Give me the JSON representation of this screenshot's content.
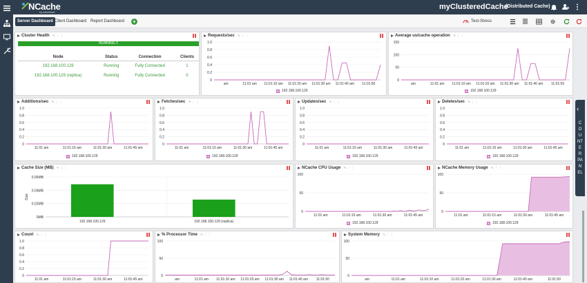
{
  "app": {
    "logo_text": "NCache",
    "logo_sub": "by Alachisoft",
    "cache_name": "myClusteredCache",
    "cache_type": "(Distributed Cache)"
  },
  "tabs": [
    {
      "label": "Server Dashboard",
      "active": true
    },
    {
      "label": "Client Dashboard",
      "active": false
    },
    {
      "label": "Report Dashboard",
      "active": false
    }
  ],
  "toolbar": {
    "stress_label": "Test-Stress"
  },
  "counter_panel": {
    "label": "COUNTER PANEL"
  },
  "cluster_health": {
    "title": "Cluster Health",
    "status": "RUNNING 2",
    "columns": [
      "Node",
      "Status",
      "Connection",
      "Clients"
    ],
    "rows": [
      [
        "192.168.100.129",
        "Running",
        "Fully Connected",
        "1"
      ],
      [
        "192.168.100.129 (replica)",
        "Running",
        "Fully Connected",
        "0"
      ]
    ]
  },
  "panels": {
    "requests": {
      "title": "Requests/sec",
      "legend": "192.168.100.129"
    },
    "avg_us": {
      "title": "Average us/cache operation",
      "legend": "192.168.100.129"
    },
    "additions": {
      "title": "Additions/sec",
      "legend": "192.168.100.129"
    },
    "fetches": {
      "title": "Fetches/sec",
      "legend": "192.168.100.129"
    },
    "updates": {
      "title": "Updates/sec",
      "legend": "192.168.100.129"
    },
    "deletes": {
      "title": "Deletes/sec",
      "legend": "192.168.100.129"
    },
    "cache_size": {
      "title": "Cache Size (MB)"
    },
    "cpu": {
      "title": "NCache CPU Usage",
      "legend": "192.168.100.129"
    },
    "memory": {
      "title": "NCache Memory Usage",
      "legend": "192.168.100.129"
    },
    "count": {
      "title": "Count"
    },
    "processor": {
      "title": "% Processor Time"
    },
    "sysmem": {
      "title": "System Memory"
    }
  },
  "chart_data": [
    {
      "id": "requests",
      "type": "line",
      "y_ticks": [
        "0",
        "0.2",
        "0.4",
        "0.6",
        "0.8",
        "1.0"
      ],
      "ylim": [
        0,
        1
      ],
      "x_ticks": [
        "am",
        "11:01 am",
        "11:01:10 am",
        "11:01:20 am",
        "11:01:30 am",
        "11:01:40 am",
        "11:01:50"
      ],
      "series": [
        {
          "name": "192.168.100.129",
          "values": [
            0,
            0,
            0,
            0,
            0,
            0,
            0,
            0,
            0,
            0,
            0,
            0,
            0,
            0,
            0,
            0,
            0,
            0,
            0,
            0,
            0,
            0,
            0,
            0,
            0,
            0,
            0,
            0.9,
            0,
            0,
            0.45,
            0.45,
            0,
            0,
            0,
            0,
            0,
            0,
            0,
            0.4
          ]
        }
      ]
    },
    {
      "id": "avg_us",
      "type": "line",
      "y_ticks": [
        "0",
        "50",
        "100",
        "150"
      ],
      "ylim": [
        0,
        150
      ],
      "x_ticks": [
        "am",
        "11:01 am",
        "11:01:10 am",
        "11:01:20 am",
        "11:01:30 am",
        "11:01:40 am",
        "11:01:50"
      ],
      "series": [
        {
          "name": "192.168.100.129",
          "values": [
            0,
            0,
            0,
            0,
            0,
            0,
            0,
            0,
            0,
            0,
            0,
            0,
            0,
            0,
            0,
            0,
            0,
            0,
            0,
            0,
            0,
            0,
            0,
            0,
            0,
            0,
            0,
            125,
            0,
            0,
            65,
            65,
            0,
            0,
            0,
            0,
            0,
            0,
            0,
            125
          ]
        }
      ]
    },
    {
      "id": "additions",
      "type": "line",
      "y_ticks": [
        "0",
        "0.2",
        "0.4",
        "0.6",
        "0.8",
        "1.0"
      ],
      "ylim": [
        0,
        1
      ],
      "x_ticks": [
        "11:01 am",
        "11:01:15 am",
        "11:01:30 am",
        "11:01:45 am"
      ],
      "series": [
        {
          "name": "192.168.100.129",
          "values": [
            0,
            0,
            0,
            0,
            0,
            0,
            0,
            0,
            0,
            0,
            0,
            0,
            0,
            0,
            0,
            0,
            0,
            0,
            0,
            0,
            0,
            0,
            0,
            0,
            0,
            0,
            0,
            0.9,
            0,
            0,
            0,
            0,
            0,
            0,
            0,
            0,
            0,
            0,
            0,
            0
          ]
        }
      ]
    },
    {
      "id": "fetches",
      "type": "line",
      "y_ticks": [
        "0",
        "0.2",
        "0.4",
        "0.6",
        "0.8",
        "1.0"
      ],
      "ylim": [
        0,
        1
      ],
      "x_ticks": [
        "11:01 am",
        "11:01:15 am",
        "11:01:30 am",
        "11:01:45 am"
      ],
      "series": [
        {
          "name": "192.168.100.129",
          "values": [
            0,
            0,
            0,
            0,
            0,
            0,
            0,
            0,
            0,
            0,
            0,
            0,
            0,
            0,
            0,
            0,
            0,
            0,
            0,
            0,
            0,
            0,
            0,
            0,
            0,
            0,
            0,
            0.9,
            0,
            0,
            0.9,
            0.9,
            0,
            0,
            0,
            0,
            0,
            0,
            0,
            0
          ]
        }
      ]
    },
    {
      "id": "updates",
      "type": "line",
      "y_ticks": [
        "0",
        "0.2",
        "0.4",
        "0.6",
        "0.8",
        "1.0"
      ],
      "ylim": [
        0,
        1
      ],
      "x_ticks": [
        "11:01 am",
        "11:01:15 am",
        "11:01:30 am",
        "11:01:45 am"
      ],
      "series": [
        {
          "name": "192.168.100.129",
          "values": [
            0,
            0,
            0,
            0,
            0,
            0,
            0,
            0,
            0,
            0,
            0,
            0,
            0,
            0,
            0,
            0,
            0,
            0,
            0,
            0,
            0,
            0,
            0,
            0,
            0,
            0,
            0,
            0,
            0,
            0,
            0,
            0,
            0,
            0,
            0,
            0,
            0,
            0,
            0,
            0
          ]
        }
      ]
    },
    {
      "id": "deletes",
      "type": "line",
      "y_ticks": [
        "0",
        "0.2",
        "0.4",
        "0.6",
        "0.8",
        "1.0"
      ],
      "ylim": [
        0,
        1
      ],
      "x_ticks": [
        "11:01 am",
        "11:01:15 am",
        "11:01:30 am",
        "11:01:45 am"
      ],
      "series": [
        {
          "name": "192.168.100.129",
          "values": [
            0,
            0,
            0,
            0,
            0,
            0,
            0,
            0,
            0,
            0,
            0,
            0,
            0,
            0,
            0,
            0,
            0,
            0,
            0,
            0,
            0,
            0,
            0,
            0,
            0,
            0,
            0,
            0,
            0,
            0,
            0,
            0,
            0,
            0,
            0,
            0,
            0,
            0,
            0,
            0
          ]
        }
      ]
    },
    {
      "id": "cache_size",
      "type": "bar",
      "ylabel": "Size",
      "y_ticks": [
        "0MB",
        "0.02MB",
        "0.04MB",
        "0.06MB"
      ],
      "ylim": [
        0,
        0.06
      ],
      "categories": [
        "192.168.100.129",
        "192.168.100.129 (replica)"
      ],
      "values": [
        0.049,
        0.026
      ],
      "color": "#1aa01a"
    },
    {
      "id": "cpu",
      "type": "line",
      "y_ticks": [
        "0",
        "50",
        "100"
      ],
      "ylim": [
        0,
        100
      ],
      "x_ticks": [
        "11:01 am",
        "11:01:15 am",
        "11:01:30 am",
        "11:01:45 am"
      ],
      "series": [
        {
          "name": "192.168.100.129",
          "values": [
            0,
            0,
            0,
            0,
            0,
            0,
            0,
            0,
            0,
            0,
            0,
            0,
            0,
            0,
            0,
            0,
            0,
            0,
            0,
            0,
            0,
            0,
            0,
            0,
            0,
            0,
            0,
            0,
            1,
            0,
            2,
            0,
            1,
            3,
            1,
            2,
            4,
            2,
            3,
            6
          ]
        }
      ]
    },
    {
      "id": "memory",
      "type": "area",
      "y_ticks": [
        "0",
        "50",
        "100"
      ],
      "ylim": [
        0,
        100
      ],
      "x_ticks": [
        "11:01 am",
        "11:01:15 am",
        "11:01:30 am",
        "11:01:45 am"
      ],
      "series": [
        {
          "name": "192.168.100.129",
          "values": [
            0,
            0,
            0,
            0,
            0,
            0,
            0,
            0,
            0,
            0,
            0,
            0,
            0,
            0,
            0,
            0,
            0,
            0,
            0,
            0,
            0,
            0,
            0,
            0,
            0,
            0,
            0,
            92,
            92,
            92,
            92,
            92,
            92,
            92,
            92,
            92,
            92,
            93,
            93,
            94
          ]
        }
      ]
    },
    {
      "id": "count",
      "type": "line",
      "y_ticks": [
        "0",
        "0.2",
        "0.4",
        "0.6",
        "0.8",
        "1.0"
      ],
      "ylim": [
        0,
        1
      ],
      "x_ticks": [
        "11:01 am",
        "11:01:15 am",
        "11:01:30 am",
        "11:01:45 am"
      ],
      "series": [
        {
          "values": [
            0,
            0,
            0,
            0,
            0,
            0,
            0,
            0,
            0,
            0,
            0,
            0,
            0,
            0,
            0,
            0,
            0,
            0,
            0,
            0,
            0,
            0,
            0,
            0,
            0,
            0,
            0,
            1,
            1,
            1,
            1,
            1,
            1,
            1,
            1,
            1,
            1,
            1,
            1,
            1
          ]
        }
      ]
    },
    {
      "id": "processor",
      "type": "line",
      "y_ticks": [
        "0",
        "50",
        "100"
      ],
      "ylim": [
        0,
        100
      ],
      "x_ticks": [
        "am",
        "11:01 am",
        "11:01:10 am",
        "11:01:20 am",
        "11:01:30 am",
        "11:01:40 am",
        "11:01:50"
      ],
      "series": [
        {
          "values": [
            1,
            1,
            1,
            1,
            1,
            1,
            1,
            1,
            1,
            1,
            1,
            1,
            1,
            1,
            1,
            1,
            1,
            1,
            1,
            1,
            1,
            1,
            1,
            1,
            1,
            1,
            1,
            3,
            12,
            2,
            1,
            1,
            1,
            2,
            1,
            1,
            2,
            1,
            1,
            1
          ]
        }
      ]
    },
    {
      "id": "sysmem",
      "type": "area",
      "y_ticks": [
        "0",
        "50",
        "100"
      ],
      "ylim": [
        0,
        100
      ],
      "x_ticks": [
        "am",
        "11:01 am",
        "11:01:10 am",
        "11:01:20 am",
        "11:01:30 am",
        "11:01:40 am",
        "11:01:50"
      ],
      "series": [
        {
          "values": [
            0,
            0,
            0,
            0,
            0,
            0,
            0,
            0,
            0,
            0,
            0,
            0,
            0,
            0,
            0,
            0,
            0,
            0,
            0,
            0,
            0,
            0,
            0,
            0,
            0,
            0,
            0,
            92,
            92,
            92,
            92,
            92,
            92,
            92,
            92,
            92,
            92,
            92,
            97,
            98
          ]
        }
      ]
    }
  ]
}
